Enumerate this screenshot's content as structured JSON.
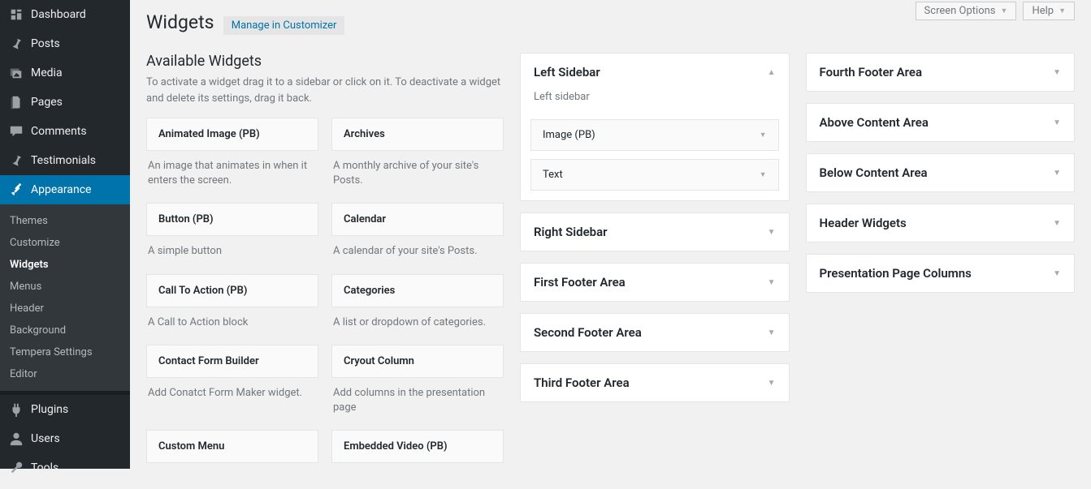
{
  "topbar": {
    "screen_options": "Screen Options",
    "help": "Help"
  },
  "header": {
    "title": "Widgets",
    "manage": "Manage in Customizer"
  },
  "sidebar": {
    "items": [
      {
        "label": "Dashboard",
        "icon": "dashboard"
      },
      {
        "label": "Posts",
        "icon": "pin"
      },
      {
        "label": "Media",
        "icon": "media"
      },
      {
        "label": "Pages",
        "icon": "pages"
      },
      {
        "label": "Comments",
        "icon": "comments"
      },
      {
        "label": "Testimonials",
        "icon": "pin"
      },
      {
        "label": "Appearance",
        "icon": "appearance",
        "current": true
      },
      {
        "label": "Plugins",
        "icon": "plugins"
      },
      {
        "label": "Users",
        "icon": "users"
      },
      {
        "label": "Tools",
        "icon": "tools"
      }
    ],
    "submenu": [
      {
        "label": "Themes"
      },
      {
        "label": "Customize"
      },
      {
        "label": "Widgets",
        "current": true
      },
      {
        "label": "Menus"
      },
      {
        "label": "Header"
      },
      {
        "label": "Background"
      },
      {
        "label": "Tempera Settings"
      },
      {
        "label": "Editor"
      }
    ]
  },
  "available": {
    "heading": "Available Widgets",
    "desc": "To activate a widget drag it to a sidebar or click on it. To deactivate a widget and delete its settings, drag it back.",
    "widgets": [
      {
        "name": "Animated Image (PB)",
        "desc": "An image that animates in when it enters the screen."
      },
      {
        "name": "Archives",
        "desc": "A monthly archive of your site's Posts."
      },
      {
        "name": "Button (PB)",
        "desc": "A simple button"
      },
      {
        "name": "Calendar",
        "desc": "A calendar of your site's Posts."
      },
      {
        "name": "Call To Action (PB)",
        "desc": "A Call to Action block"
      },
      {
        "name": "Categories",
        "desc": "A list or dropdown of categories."
      },
      {
        "name": "Contact Form Builder",
        "desc": "Add Conatct Form Maker widget."
      },
      {
        "name": "Cryout Column",
        "desc": "Add columns in the presentation page"
      },
      {
        "name": "Custom Menu",
        "desc": ""
      },
      {
        "name": "Embedded Video (PB)",
        "desc": ""
      }
    ]
  },
  "areas_left": [
    {
      "title": "Left Sidebar",
      "desc": "Left sidebar",
      "open": true,
      "widgets": [
        {
          "name": "Image (PB)"
        },
        {
          "name": "Text"
        }
      ]
    },
    {
      "title": "Right Sidebar"
    },
    {
      "title": "First Footer Area"
    },
    {
      "title": "Second Footer Area"
    },
    {
      "title": "Third Footer Area"
    }
  ],
  "areas_right": [
    {
      "title": "Fourth Footer Area"
    },
    {
      "title": "Above Content Area"
    },
    {
      "title": "Below Content Area"
    },
    {
      "title": "Header Widgets"
    },
    {
      "title": "Presentation Page Columns"
    }
  ]
}
